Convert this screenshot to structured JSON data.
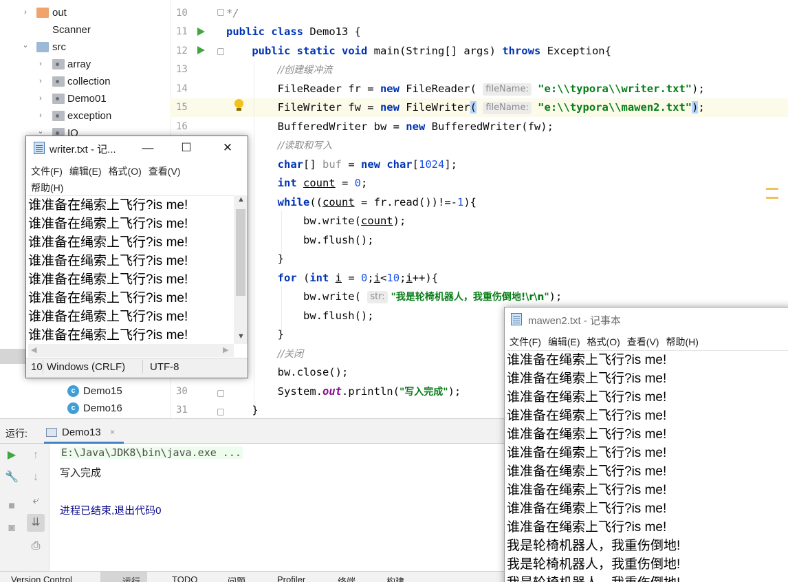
{
  "tree": {
    "items": [
      {
        "label": "out",
        "kind": "folder-orange",
        "arrow": "›"
      },
      {
        "label": "Scanner",
        "kind": "none",
        "arrow": ""
      },
      {
        "label": "src",
        "kind": "folder-blue",
        "arrow": "⌄"
      },
      {
        "label": "array",
        "kind": "package",
        "arrow": "›"
      },
      {
        "label": "collection",
        "kind": "package",
        "arrow": "›"
      },
      {
        "label": "Demo01",
        "kind": "package",
        "arrow": "›"
      },
      {
        "label": "exception",
        "kind": "package",
        "arrow": "›"
      },
      {
        "label": "IO",
        "kind": "package",
        "arrow": "⌄"
      }
    ],
    "classes": [
      {
        "label": "Demo15",
        "icon": "c"
      },
      {
        "label": "Demo16",
        "icon": "c"
      }
    ]
  },
  "editor": {
    "line_numbers": [
      "10",
      "11",
      "12",
      "13",
      "14",
      "15",
      "16",
      "",
      "",
      "",
      "",
      "",
      "",
      "",
      "",
      "",
      "",
      "",
      "",
      "",
      "",
      "30",
      "31"
    ],
    "code": {
      "l10": "*/",
      "l11_kw1": "public",
      "l11_kw2": "class",
      "l11_rest": " Demo13 {",
      "l12_kw1": "public",
      "l12_kw2": "static",
      "l12_kw3": "void",
      "l12_mid": " main(String[] args) ",
      "l12_kw4": "throws",
      "l12_rest": " Exception{",
      "l13_comment": "//创建缓冲流",
      "l14_a": "FileReader fr = ",
      "l14_new": "new",
      "l14_b": " FileReader( ",
      "l14_hint": "fileName:",
      "l14_str": " \"e:\\\\typora\\\\writer.txt\"",
      "l14_c": ");",
      "l15_a": "FileWriter fw = ",
      "l15_new": "new",
      "l15_b": " FileWriter",
      "l15_paren": "(",
      "l15_hint": "fileName:",
      "l15_str": " \"e:\\\\typora\\\\mawen2.txt\"",
      "l15_paren2": ")",
      "l15_c": ";",
      "l16_a": "BufferedWriter bw = ",
      "l16_new": "new",
      "l16_b": " BufferedWriter(fw);",
      "l17_comment": "//读取和写入",
      "l18_kw": "char",
      "l18_a": "[] ",
      "l18_var": "buf",
      "l18_b": " = ",
      "l18_new": "new",
      "l18_kw2": " char",
      "l18_c": "[",
      "l18_num": "1024",
      "l18_d": "];",
      "l19_kw": "int",
      "l19_var": "count",
      "l19_b": " = ",
      "l19_num": "0",
      "l19_c": ";",
      "l20_kw": "while",
      "l20_a": "((",
      "l20_var": "count",
      "l20_b": " = fr.read())!=-",
      "l20_num": "1",
      "l20_c": "){",
      "l21_a": "bw.write(",
      "l21_var": "count",
      "l21_b": ");",
      "l22": "bw.flush();",
      "l23": "}",
      "l24_kw": "for",
      "l24_a": " (",
      "l24_kw2": "int",
      "l24_var": "i",
      "l24_b": " = ",
      "l24_num": "0",
      "l24_c": ";",
      "l24_var2": "i",
      "l24_d": "<",
      "l24_num2": "10",
      "l24_e": ";",
      "l24_var3": "i",
      "l24_f": "++){",
      "l25_a": "bw.write( ",
      "l25_hint": "str:",
      "l25_str": " \"我是轮椅机器人，我重伤倒地!\\r\\n\"",
      "l25_b": ");",
      "l26": "bw.flush();",
      "l27": "}",
      "l28_comment": "//关闭",
      "l29": "bw.close();",
      "l30_a": "System.",
      "l30_fld": "out",
      "l30_b": ".println(",
      "l30_str": "\"写入完成\"",
      "l30_c": ");",
      "l31": "}"
    }
  },
  "run": {
    "label": "运行:",
    "tab": "Demo13",
    "tab_close": "×",
    "cmd": "E:\\Java\\JDK8\\bin\\java.exe ...",
    "output": "写入完成",
    "exit": "进程已结束,退出代码0"
  },
  "statusbar": {
    "items": [
      "Version Control",
      "运行",
      "TODO",
      "问题",
      "Profiler",
      "终端",
      "构建"
    ]
  },
  "notepad1": {
    "title": "writer.txt - 记...",
    "menu1": [
      "文件(F)",
      "编辑(E)",
      "格式(O)",
      "查看(V)"
    ],
    "menu2": [
      "帮助(H)"
    ],
    "lines": [
      "谁准备在绳索上飞行?is me!",
      "谁准备在绳索上飞行?is me!",
      "谁准备在绳索上飞行?is me!",
      "谁准备在绳索上飞行?is me!",
      "谁准备在绳索上飞行?is me!",
      "谁准备在绳索上飞行?is me!",
      "谁准备在绳索上飞行?is me!",
      "谁准备在绳索上飞行?is me!"
    ],
    "status_pos": "10",
    "status_eol": "Windows (CRLF)",
    "status_enc": "UTF-8"
  },
  "notepad2": {
    "title": "mawen2.txt - 记事本",
    "menu": [
      "文件(F)",
      "编辑(E)",
      "格式(O)",
      "查看(V)",
      "帮助(H)"
    ],
    "lines": [
      "谁准备在绳索上飞行?is me!",
      "谁准备在绳索上飞行?is me!",
      "谁准备在绳索上飞行?is me!",
      "谁准备在绳索上飞行?is me!",
      "谁准备在绳索上飞行?is me!",
      "谁准备在绳索上飞行?is me!",
      "谁准备在绳索上飞行?is me!",
      "谁准备在绳索上飞行?is me!",
      "谁准备在绳索上飞行?is me!",
      "谁准备在绳索上飞行?is me!",
      "我是轮椅机器人，我重伤倒地!",
      "我是轮椅机器人，我重伤倒地!",
      "我是轮椅机器人，我重伤倒地!"
    ]
  }
}
